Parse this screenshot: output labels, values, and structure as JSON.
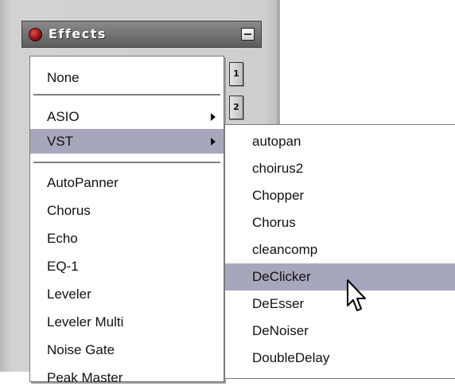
{
  "effects_panel": {
    "title": "Effects",
    "slots": [
      "1",
      "2"
    ]
  },
  "menu": {
    "items_top": [
      "None"
    ],
    "items_mid": [
      {
        "label": "ASIO",
        "has_submenu": true
      },
      {
        "label": "VST",
        "has_submenu": true,
        "highlighted": true
      }
    ],
    "items_bottom": [
      "AutoPanner",
      "Chorus",
      "Echo",
      "EQ-1",
      "Leveler",
      "Leveler Multi",
      "Noise Gate",
      "Peak Master"
    ]
  },
  "submenu": {
    "items": [
      "autopan",
      "choirus2",
      "Chopper",
      "Chorus",
      "cleancomp",
      "DeClicker",
      "DeEsser",
      "DeNoiser",
      "DoubleDelay"
    ],
    "highlighted": "DeClicker"
  },
  "colors": {
    "highlight": "#a6a6bd",
    "panel": "#cfcfcf",
    "led": "#9a1010"
  }
}
